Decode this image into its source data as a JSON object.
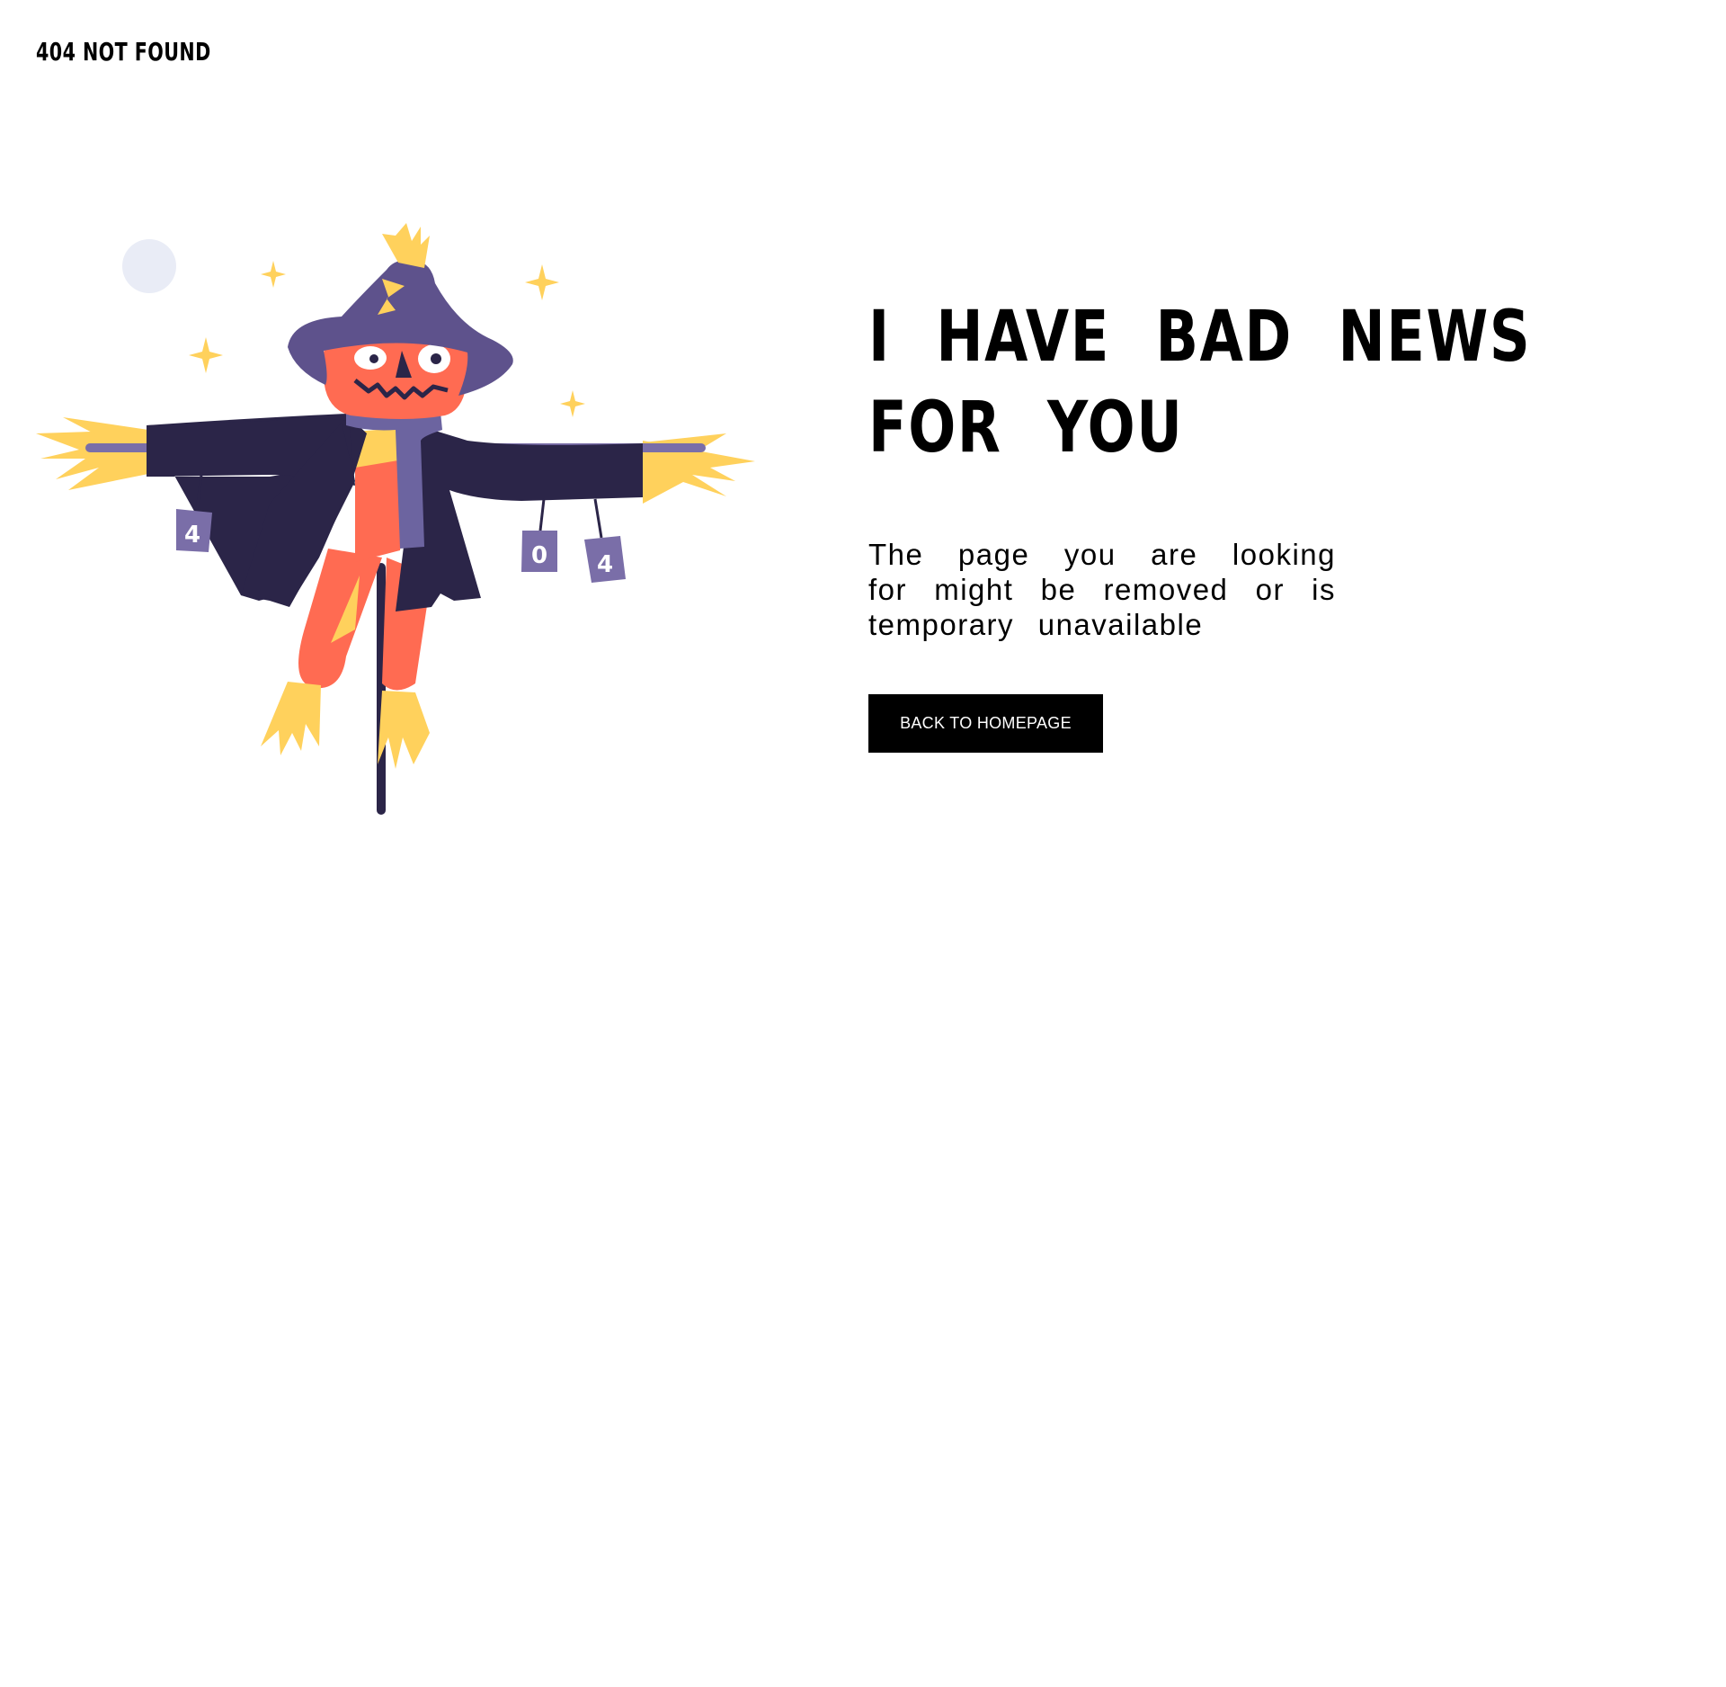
{
  "header": {
    "brand": "404 NOT FOUND"
  },
  "main": {
    "headline_line1": "I HAVE BAD NEWS",
    "headline_line2": "FOR YOU",
    "message": "The page you are looking for might be removed or is temporary unavailable",
    "button_label": "BACK TO HOMEPAGE"
  },
  "illustration": {
    "subject": "scarecrow-illustration",
    "can_labels": [
      "4",
      "0",
      "4"
    ]
  },
  "colors": {
    "background": "#ffffff",
    "text": "#000000",
    "button_bg": "#000000",
    "button_text": "#ffffff",
    "coat": "#2b2548",
    "hat": "#5e528c",
    "scarf": "#6c64a0",
    "pumpkin": "#ff6b52",
    "straw": "#ffd15c",
    "moon": "#e9ecf6"
  }
}
